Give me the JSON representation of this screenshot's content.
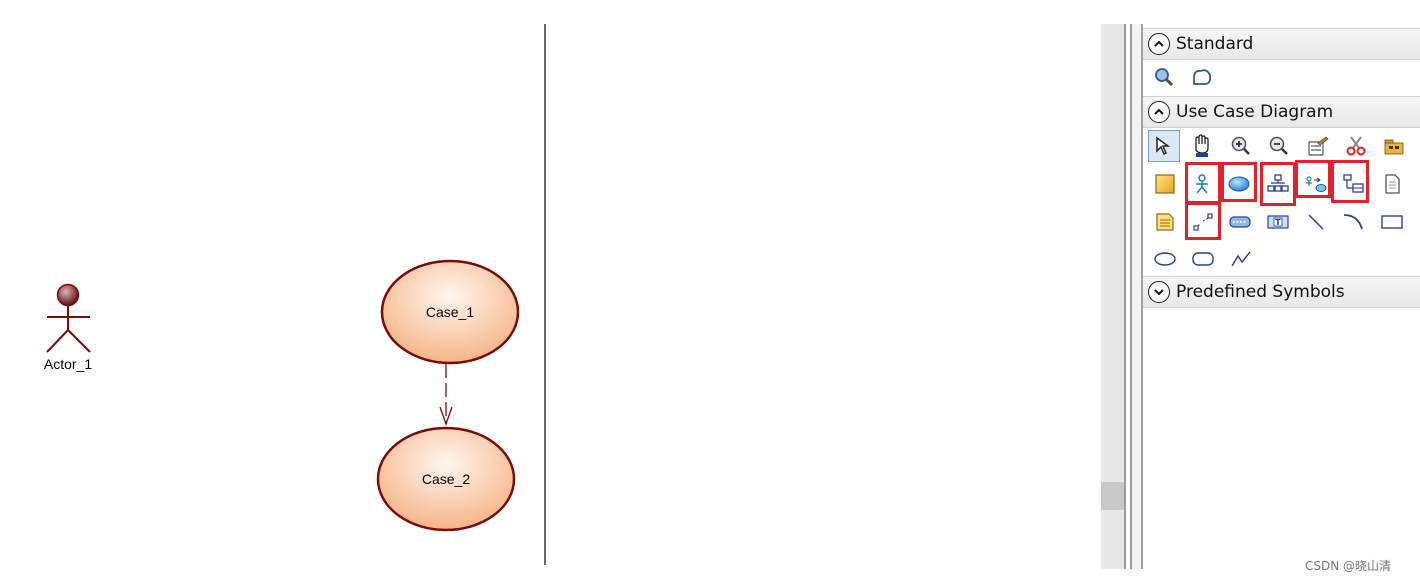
{
  "diagram": {
    "actor": {
      "label": "Actor_1"
    },
    "use_cases": [
      {
        "label": "Case_1"
      },
      {
        "label": "Case_2"
      }
    ],
    "colors": {
      "outline": "#7b0a0a",
      "fill_light": "#fff4ea",
      "fill_dark": "#f6b487"
    }
  },
  "palette": {
    "sections": {
      "standard": {
        "title": "Standard",
        "state": "expanded"
      },
      "use_case_diagram": {
        "title": "Use Case Diagram",
        "state": "expanded"
      },
      "predefined_symbols": {
        "title": "Predefined Symbols",
        "state": "collapsed"
      }
    },
    "standard_tools": [
      "find-symbol-icon",
      "properties-icon"
    ],
    "use_case_tools": [
      "pointer-icon",
      "hand-grab-icon",
      "zoom-in-icon",
      "zoom-out-icon",
      "open-diagram-icon",
      "cut-icon",
      "package-icon",
      "package-yellow-icon",
      "actor-tool-icon",
      "use-case-tool-icon",
      "generalization-tool-icon",
      "association-tool-icon",
      "dependency-tool-icon",
      "file-icon",
      "note-icon",
      "link-tool-icon",
      "system-icon",
      "text-tool-icon",
      "line-icon",
      "arc-icon",
      "rectangle-icon",
      "ellipse-icon",
      "rounded-rectangle-icon",
      "polyline-icon"
    ],
    "highlight_color": "#e0222b"
  },
  "watermark": "CSDN @晓山清"
}
